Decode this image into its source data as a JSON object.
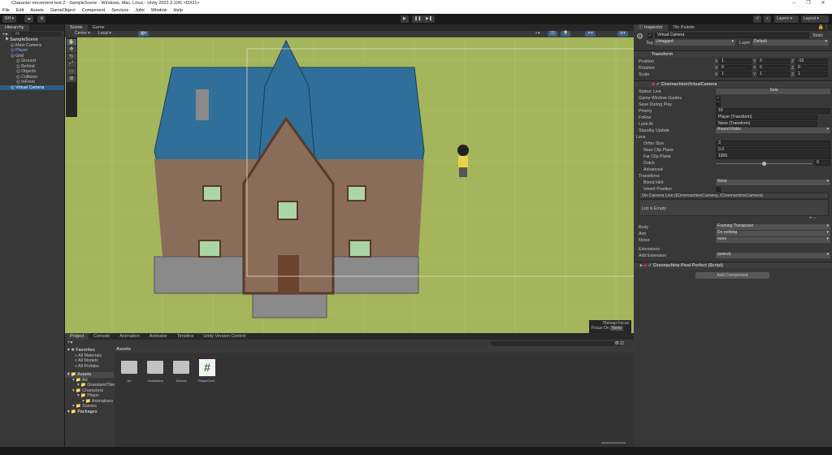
{
  "window": {
    "title": "Character movement test 2 - SampleScene - Windows, Mac, Linux - Unity 2022.3.10f1 <DX11>",
    "controls": [
      "–",
      "❐",
      "✕"
    ]
  },
  "menu": [
    "File",
    "Edit",
    "Assets",
    "GameObject",
    "Component",
    "Services",
    "Jobs",
    "Window",
    "Help"
  ],
  "toolbar": {
    "account": "RH ▾",
    "layers": "Layers",
    "layout": "Layout"
  },
  "hierarchy": {
    "tab": "Hierarchy",
    "search_placeholder": "All",
    "items": [
      {
        "label": "SampleScene",
        "depth": 0
      },
      {
        "label": "Main Camera",
        "depth": 1
      },
      {
        "label": "Player",
        "depth": 1
      },
      {
        "label": "Grid",
        "depth": 1
      },
      {
        "label": "Ground",
        "depth": 2
      },
      {
        "label": "Behind",
        "depth": 2
      },
      {
        "label": "Objects",
        "depth": 2
      },
      {
        "label": "Collision",
        "depth": 2
      },
      {
        "label": "InFront",
        "depth": 2
      },
      {
        "label": "Virtual Camera",
        "depth": 1
      }
    ]
  },
  "scene": {
    "tabs": [
      "Scene",
      "Game"
    ],
    "pivot": "Center",
    "space": "Local",
    "overlay": {
      "title": "Tilemap Focus",
      "focus_label": "Focus On",
      "focus_value": "None"
    }
  },
  "bottom": {
    "tabs": [
      "Project",
      "Console",
      "Animation",
      "Animator",
      "Timeline",
      "Unity Version Control"
    ],
    "favorites": {
      "title": "Favorites",
      "items": [
        "All Materials",
        "All Models",
        "All Prefabs"
      ]
    },
    "tree": [
      {
        "label": "Assets",
        "depth": 0
      },
      {
        "label": "Art",
        "depth": 1
      },
      {
        "label": "GrasslandTiles",
        "depth": 2
      },
      {
        "label": "Characters",
        "depth": 1
      },
      {
        "label": "Player",
        "depth": 2
      },
      {
        "label": "Animations",
        "depth": 3
      },
      {
        "label": "Scenes",
        "depth": 1
      },
      {
        "label": "Packages",
        "depth": 0
      }
    ],
    "breadcrumb": "Assets",
    "assets": [
      {
        "name": "Art",
        "type": "folder"
      },
      {
        "name": "Characters",
        "type": "folder"
      },
      {
        "name": "Scenes",
        "type": "folder"
      },
      {
        "name": "PlayerCont...",
        "type": "script"
      }
    ],
    "hidden_count": "22"
  },
  "inspector": {
    "tabs": [
      "Inspector",
      "Tile Palette"
    ],
    "object_name": "Virtual Camera",
    "static_label": "Static",
    "tag_label": "Tag",
    "tag": "Untagged",
    "layer_label": "Layer",
    "layer": "Default",
    "transform": {
      "title": "Transform",
      "rows": [
        {
          "label": "Position",
          "x": "1",
          "y": "0",
          "z": "-10"
        },
        {
          "label": "Rotation",
          "x": "0",
          "y": "0",
          "z": "0"
        },
        {
          "label": "Scale",
          "x": "1",
          "y": "1",
          "z": "1"
        }
      ]
    },
    "vcam": {
      "title": "CinemachineVirtualCamera",
      "status": "Status: Live",
      "solo": "Solo",
      "game_window_guides": "Game Window Guides",
      "save_during_play": "Save During Play",
      "priority_label": "Priority",
      "priority": "10",
      "follow_label": "Follow",
      "follow": "Player (Transform)",
      "lookat_label": "Look At",
      "lookat": "None (Transform)",
      "standby_label": "Standby Update",
      "standby": "Round Robin",
      "lens": "Lens",
      "ortho_label": "Ortho Size",
      "ortho": "3",
      "near_label": "Near Clip Plane",
      "near": "0.3",
      "far_label": "Far Clip Plane",
      "far": "1000",
      "dutch_label": "Dutch",
      "dutch": "0",
      "advanced": "Advanced",
      "transitions": "Transitions",
      "blend_label": "Blend Hint",
      "blend": "None",
      "inherit_label": "Inherit Position",
      "event": "On Camera Live (ICinemachineCamera, ICinemachineCamera)",
      "list_empty": "List is Empty",
      "body_label": "Body",
      "body": "Framing Transposer",
      "aim_label": "Aim",
      "aim": "Do nothing",
      "noise_label": "Noise",
      "noise": "none",
      "extensions": "Extensions",
      "add_ext_label": "Add Extension",
      "add_ext": "(select)"
    },
    "pixel_perfect": "Cinemachine Pixel Perfect (Script)",
    "add_component": "Add Component"
  }
}
